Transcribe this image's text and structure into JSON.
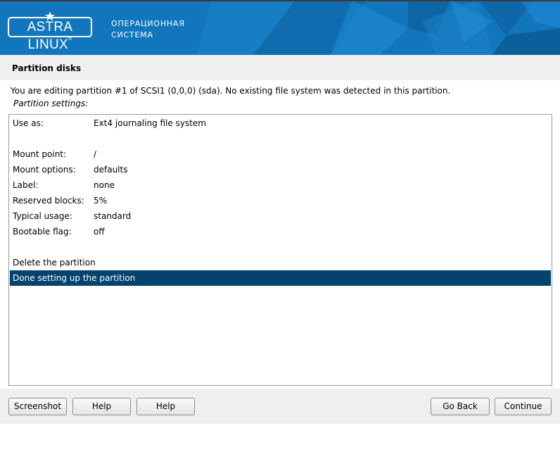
{
  "header": {
    "logo_text": "ASTRA LINUX",
    "logo_trademark": "®",
    "tagline_line1": "ОПЕРАЦИОННАЯ",
    "tagline_line2": "СИСТЕМА",
    "banner_color": "#1276bd"
  },
  "page": {
    "title": "Partition disks",
    "info": "You are editing partition #1 of SCSI1 (0,0,0) (sda). No existing file system was detected in this partition.",
    "settings_label": "Partition settings:"
  },
  "settings": [
    {
      "key": "Use as:",
      "value": "Ext4 journaling file system"
    },
    {
      "key": "Mount point:",
      "value": "/"
    },
    {
      "key": "Mount options:",
      "value": "defaults"
    },
    {
      "key": "Label:",
      "value": "none"
    },
    {
      "key": "Reserved blocks:",
      "value": "5%"
    },
    {
      "key": "Typical usage:",
      "value": "standard"
    },
    {
      "key": "Bootable flag:",
      "value": "off"
    }
  ],
  "actions": [
    {
      "label": "Delete the partition",
      "selected": false
    },
    {
      "label": "Done setting up the partition",
      "selected": true
    }
  ],
  "selection_color": "#03436d",
  "buttons": {
    "screenshot": "Screenshot",
    "help1": "Help",
    "help2": "Help",
    "go_back": "Go Back",
    "continue": "Continue"
  }
}
